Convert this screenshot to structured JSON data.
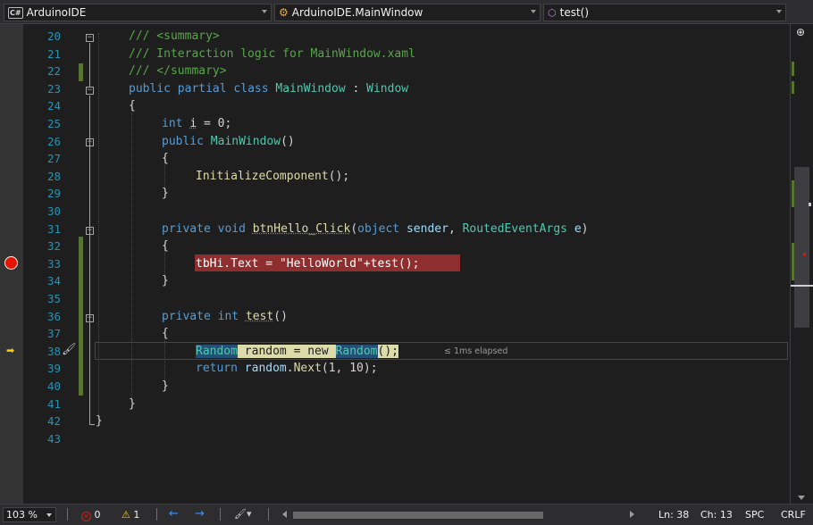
{
  "nav": {
    "project": "ArduinoIDE",
    "project_icon": "csharp-project-icon",
    "type": "ArduinoIDE.MainWindow",
    "type_icon": "class-icon",
    "member": "test()",
    "member_icon": "method-icon",
    "split_icon": "split-editor-icon"
  },
  "code": {
    "lines": [
      {
        "n": "20",
        "text": "/// <summary>"
      },
      {
        "n": "21",
        "text": "/// Interaction logic for MainWindow.xaml"
      },
      {
        "n": "22",
        "text": "/// </summary>"
      },
      {
        "n": "23",
        "text": "public partial class MainWindow : Window"
      },
      {
        "n": "24",
        "text": "{"
      },
      {
        "n": "25",
        "text": "int i = 0;"
      },
      {
        "n": "26",
        "text": "public MainWindow()"
      },
      {
        "n": "27",
        "text": "{"
      },
      {
        "n": "28",
        "text": "InitializeComponent();"
      },
      {
        "n": "29",
        "text": "}"
      },
      {
        "n": "30",
        "text": ""
      },
      {
        "n": "31",
        "text": "private void btnHello_Click(object sender, RoutedEventArgs e)"
      },
      {
        "n": "32",
        "text": "{"
      },
      {
        "n": "33",
        "text": "tbHi.Text = \"HelloWorld\"+test();"
      },
      {
        "n": "34",
        "text": "}"
      },
      {
        "n": "35",
        "text": ""
      },
      {
        "n": "36",
        "text": "private int test()"
      },
      {
        "n": "37",
        "text": "{"
      },
      {
        "n": "38",
        "text": "Random random = new Random();"
      },
      {
        "n": "39",
        "text": "return random.Next(1, 10);"
      },
      {
        "n": "40",
        "text": "}"
      },
      {
        "n": "41",
        "text": "}"
      },
      {
        "n": "42",
        "text": "}"
      },
      {
        "n": "43",
        "text": ""
      }
    ],
    "breakpoint_line": "33",
    "current_line": "38",
    "perf_tip": "≤ 1ms elapsed"
  },
  "colors": {
    "comment": "#57a64a",
    "keyword": "#569cd6",
    "type": "#4ec9b0",
    "method": "#dcdcaa",
    "string": "#d69d85",
    "breakpoint": "#e51400",
    "breakpoint_highlight": "#8e2e2e",
    "line_number": "#2b91af"
  },
  "status": {
    "zoom": "103 %",
    "errors": "0",
    "warnings": "1",
    "back_icon": "navigate-back-icon",
    "forward_icon": "navigate-forward-icon",
    "ln": "Ln: 38",
    "ch": "Ch: 13",
    "spc": "SPC",
    "crlf": "CRLF"
  }
}
